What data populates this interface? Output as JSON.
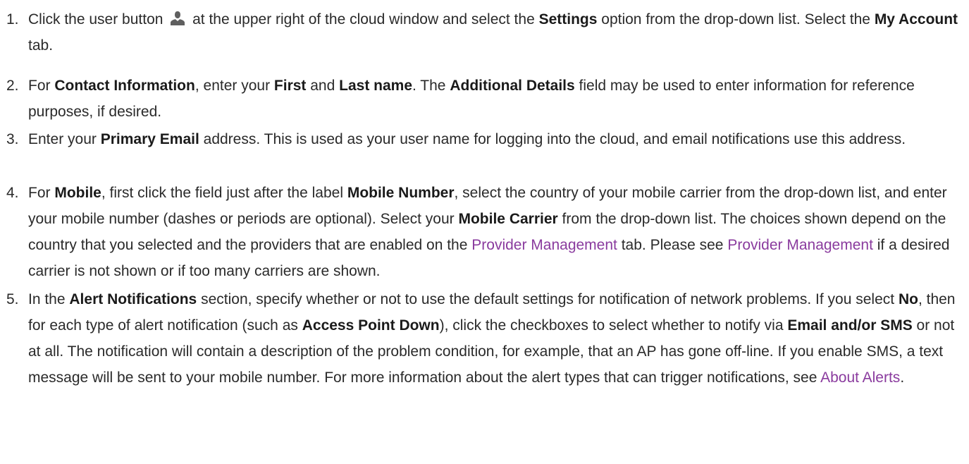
{
  "steps": [
    {
      "number": "1.",
      "parts": [
        {
          "t": "Click the user button "
        },
        {
          "icon": "user-icon"
        },
        {
          "t": " at the upper right of the cloud window and select the "
        },
        {
          "b": "Settings"
        },
        {
          "t": " option from the drop-down list. Select the "
        },
        {
          "b": "My Account"
        },
        {
          "t": " tab."
        }
      ]
    },
    {
      "number": "2.",
      "parts": [
        {
          "t": "For "
        },
        {
          "b": "Contact Information"
        },
        {
          "t": ", enter your "
        },
        {
          "b": "First"
        },
        {
          "t": " and "
        },
        {
          "b": "Last name"
        },
        {
          "t": ". The "
        },
        {
          "b": "Additional Details"
        },
        {
          "t": " field may be used to enter information for reference purposes, if desired."
        }
      ]
    },
    {
      "number": "3.",
      "parts": [
        {
          "t": "Enter your "
        },
        {
          "b": "Primary Email"
        },
        {
          "t": " address. This is used as your user name for logging into the cloud, and email notifications use this address."
        }
      ]
    },
    {
      "number": "4.",
      "parts": [
        {
          "t": "For "
        },
        {
          "b": "Mobile"
        },
        {
          "t": ", first click the field just after the label "
        },
        {
          "b": "Mobile Number"
        },
        {
          "t": ", select the country of your mobile carrier from the drop-down list, and enter your mobile number (dashes or periods are optional). Select your "
        },
        {
          "b": "Mobile Carrier"
        },
        {
          "t": " from the drop-down list. The choices shown depend on the country that you selected and the providers that are enabled on the "
        },
        {
          "link": "Provider Management"
        },
        {
          "t": " tab. Please see "
        },
        {
          "link": "Provider Management"
        },
        {
          "t": " if a desired carrier is not shown or if too many carriers are shown."
        }
      ]
    },
    {
      "number": "5.",
      "parts": [
        {
          "t": "In the "
        },
        {
          "b": "Alert Notifications"
        },
        {
          "t": " section, specify whether or not to use the default settings for notification of network problems. If you select "
        },
        {
          "b": "No"
        },
        {
          "t": ", then for each type of alert notification (such as "
        },
        {
          "b": "Access Point Down"
        },
        {
          "t": "), click the checkboxes to select whether to notify via "
        },
        {
          "b": "Email and/or SMS"
        },
        {
          "t": " or not at all. The notification will contain a description of the problem condition, for example, that an AP has gone off-line. If you enable SMS, a text message will be sent to your mobile number. For more information about the alert types that can trigger notifications, see "
        },
        {
          "link": "About Alerts"
        },
        {
          "t": "."
        }
      ]
    }
  ],
  "colors": {
    "text": "#2a2a2a",
    "link": "#8a3b9e",
    "icon": "#5f5f5f"
  }
}
